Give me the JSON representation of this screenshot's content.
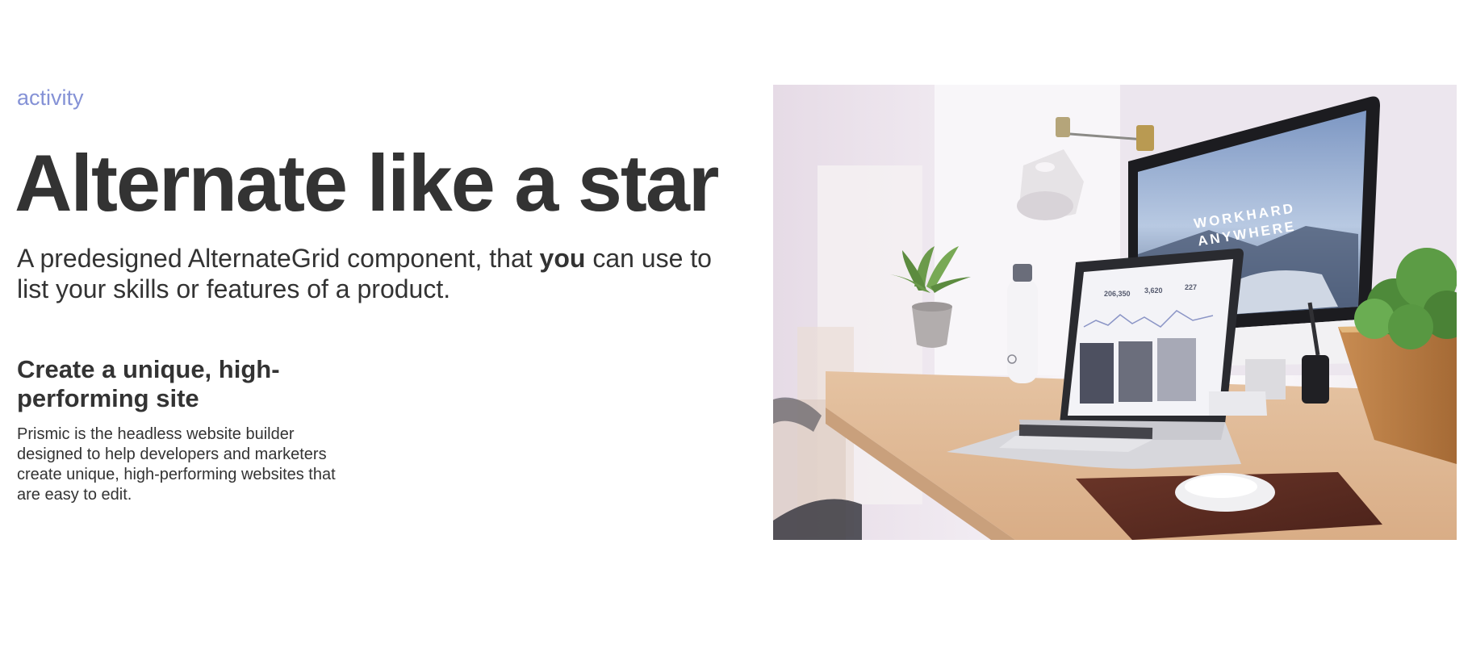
{
  "section": {
    "eyebrow": "activity",
    "title": "Alternate like a star",
    "lede_before": "A predesigned AlternateGrid component, that ",
    "lede_bold": "you",
    "lede_after": " can use to list your skills or features of a product.",
    "feature": {
      "title": "Create a unique, high-performing site",
      "text": "Prismic is the headless website builder designed to help developers and marketers create unique, high-performing websites that are easy to edit."
    }
  },
  "image": {
    "monitor_screen_text_1": "WORKHARD",
    "monitor_screen_text_2": "ANYWHERE",
    "laptop_stats": [
      "206,350",
      "3,620",
      "227"
    ]
  },
  "colors": {
    "accent": "#8592d6",
    "text": "#333333"
  }
}
